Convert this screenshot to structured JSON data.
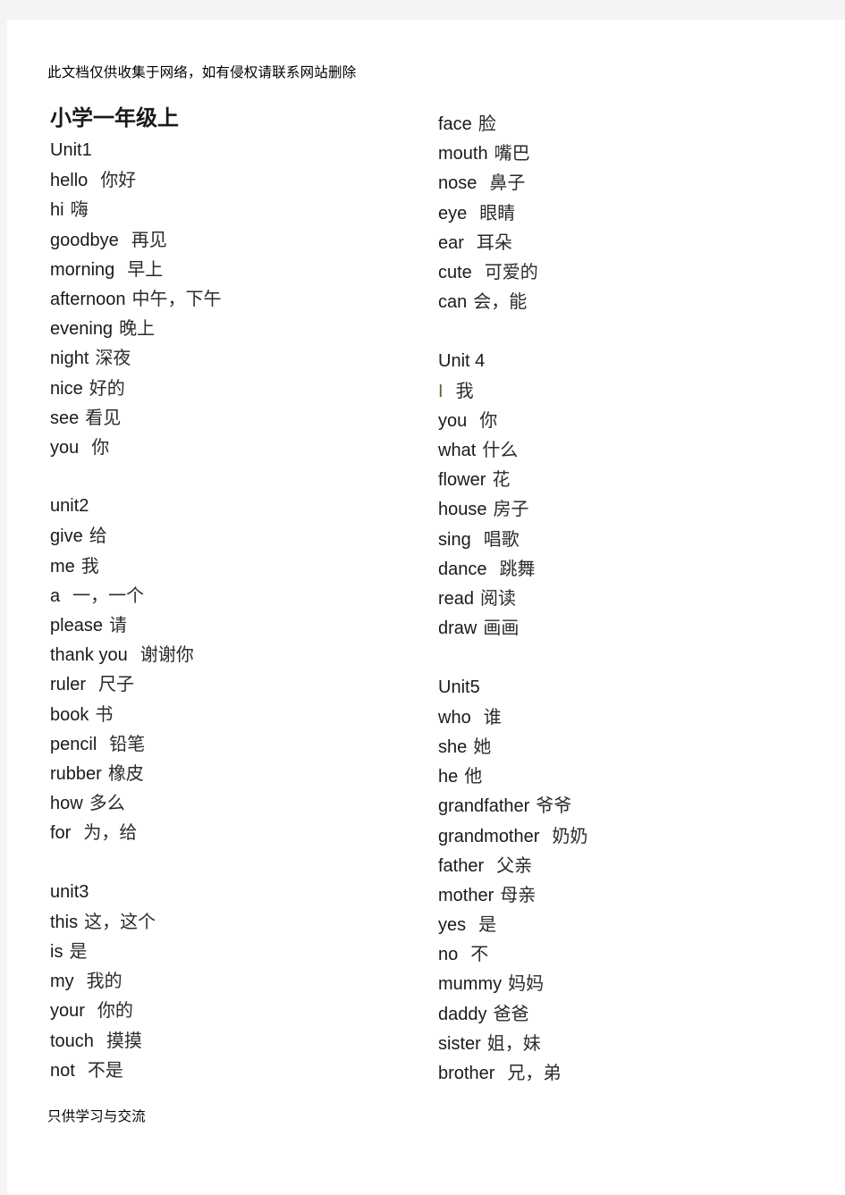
{
  "document": {
    "header_note": "此文档仅供收集于网络，如有侵权请联系网站删除",
    "footer_note": "只供学习与交流",
    "title": "小学一年级上"
  },
  "left_column": [
    {
      "kind": "unit",
      "en": "Unit1",
      "cn": ""
    },
    {
      "kind": "word",
      "en": "hello",
      "cn": "你好",
      "gap": 2
    },
    {
      "kind": "word",
      "en": "hi",
      "cn": "嗨",
      "gap": 1
    },
    {
      "kind": "word",
      "en": "goodbye",
      "cn": "再见",
      "gap": 2
    },
    {
      "kind": "word",
      "en": "morning",
      "cn": "早上",
      "gap": 2
    },
    {
      "kind": "word",
      "en": "afternoon",
      "cn": "中午，下午",
      "gap": 1
    },
    {
      "kind": "word",
      "en": "evening",
      "cn": "晚上",
      "gap": 1
    },
    {
      "kind": "word",
      "en": "night",
      "cn": "深夜",
      "gap": 1
    },
    {
      "kind": "word",
      "en": "nice",
      "cn": "好的",
      "gap": 1
    },
    {
      "kind": "word",
      "en": "see",
      "cn": "看见",
      "gap": 1
    },
    {
      "kind": "word",
      "en": "you",
      "cn": "你",
      "gap": 2
    },
    {
      "kind": "spacer",
      "en": "",
      "cn": ""
    },
    {
      "kind": "unit",
      "en": "unit2",
      "cn": ""
    },
    {
      "kind": "word",
      "en": "give",
      "cn": "给",
      "gap": 1
    },
    {
      "kind": "word",
      "en": "me",
      "cn": "我",
      "gap": 1
    },
    {
      "kind": "word",
      "en": "a",
      "cn": "一，一个",
      "gap": 2
    },
    {
      "kind": "word",
      "en": "please",
      "cn": "请",
      "gap": 1
    },
    {
      "kind": "word",
      "en": "thank you",
      "cn": "谢谢你",
      "gap": 2
    },
    {
      "kind": "word",
      "en": "ruler",
      "cn": "尺子",
      "gap": 2
    },
    {
      "kind": "word",
      "en": "book",
      "cn": "书",
      "gap": 1
    },
    {
      "kind": "word",
      "en": "pencil",
      "cn": "铅笔",
      "gap": 2
    },
    {
      "kind": "word",
      "en": "rubber",
      "cn": "橡皮",
      "gap": 1
    },
    {
      "kind": "word",
      "en": "how",
      "cn": "多么",
      "gap": 1
    },
    {
      "kind": "word",
      "en": "for",
      "cn": "为，给",
      "gap": 2
    },
    {
      "kind": "spacer",
      "en": "",
      "cn": ""
    },
    {
      "kind": "unit",
      "en": "unit3",
      "cn": ""
    },
    {
      "kind": "word",
      "en": "this",
      "cn": "这，这个",
      "gap": 1
    },
    {
      "kind": "word",
      "en": "is",
      "cn": "是",
      "gap": 1
    },
    {
      "kind": "word",
      "en": "my",
      "cn": "我的",
      "gap": 2
    },
    {
      "kind": "word",
      "en": "your",
      "cn": "你的",
      "gap": 2
    },
    {
      "kind": "word",
      "en": "touch",
      "cn": "摸摸",
      "gap": 2
    },
    {
      "kind": "word",
      "en": "not",
      "cn": "不是",
      "gap": 2
    }
  ],
  "right_column": [
    {
      "kind": "word",
      "en": "face",
      "cn": "脸",
      "gap": 1
    },
    {
      "kind": "word",
      "en": "mouth",
      "cn": "嘴巴",
      "gap": 1
    },
    {
      "kind": "word",
      "en": "nose",
      "cn": "鼻子",
      "gap": 2
    },
    {
      "kind": "word",
      "en": "eye",
      "cn": "眼睛",
      "gap": 2
    },
    {
      "kind": "word",
      "en": "ear",
      "cn": "耳朵",
      "gap": 2
    },
    {
      "kind": "word",
      "en": "cute",
      "cn": "可爱的",
      "gap": 2
    },
    {
      "kind": "word",
      "en": "can",
      "cn": "会，能",
      "gap": 1
    },
    {
      "kind": "spacer",
      "en": "",
      "cn": ""
    },
    {
      "kind": "unit",
      "en": "Unit 4",
      "cn": ""
    },
    {
      "kind": "word",
      "en": "I",
      "cn": "我",
      "gap": 2,
      "tint": true
    },
    {
      "kind": "word",
      "en": "you",
      "cn": "你",
      "gap": 2
    },
    {
      "kind": "word",
      "en": "what",
      "cn": "什么",
      "gap": 1
    },
    {
      "kind": "word",
      "en": "flower",
      "cn": "花",
      "gap": 1
    },
    {
      "kind": "word",
      "en": "house",
      "cn": "房子",
      "gap": 1
    },
    {
      "kind": "word",
      "en": "sing",
      "cn": "唱歌",
      "gap": 2
    },
    {
      "kind": "word",
      "en": "dance",
      "cn": "跳舞",
      "gap": 2
    },
    {
      "kind": "word",
      "en": "read",
      "cn": "阅读",
      "gap": 1
    },
    {
      "kind": "word",
      "en": "draw",
      "cn": "画画",
      "gap": 1
    },
    {
      "kind": "spacer",
      "en": "",
      "cn": ""
    },
    {
      "kind": "unit",
      "en": "Unit5",
      "cn": ""
    },
    {
      "kind": "word",
      "en": "who",
      "cn": "谁",
      "gap": 2
    },
    {
      "kind": "word",
      "en": "she",
      "cn": "她",
      "gap": 1
    },
    {
      "kind": "word",
      "en": "he",
      "cn": "他",
      "gap": 1
    },
    {
      "kind": "word",
      "en": "grandfather",
      "cn": "爷爷",
      "gap": 1
    },
    {
      "kind": "word",
      "en": "grandmother",
      "cn": "奶奶",
      "gap": 2
    },
    {
      "kind": "word",
      "en": "father",
      "cn": "父亲",
      "gap": 2
    },
    {
      "kind": "word",
      "en": "mother",
      "cn": "母亲",
      "gap": 1
    },
    {
      "kind": "word",
      "en": "yes",
      "cn": "是",
      "gap": 2
    },
    {
      "kind": "word",
      "en": "no",
      "cn": "不",
      "gap": 2
    },
    {
      "kind": "word",
      "en": "mummy",
      "cn": "妈妈",
      "gap": 1
    },
    {
      "kind": "word",
      "en": "daddy",
      "cn": "爸爸",
      "gap": 1
    },
    {
      "kind": "word",
      "en": "sister",
      "cn": "姐，妹",
      "gap": 1
    },
    {
      "kind": "word",
      "en": "brother",
      "cn": "兄，弟",
      "gap": 2
    }
  ]
}
